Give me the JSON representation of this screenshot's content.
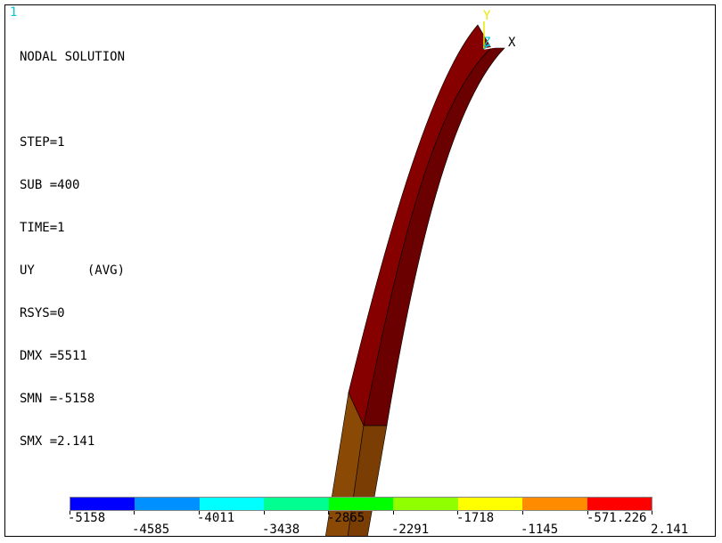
{
  "window_number": "1",
  "info_lines": [
    "NODAL SOLUTION",
    "",
    "STEP=1",
    "SUB =400",
    "TIME=1",
    "UY       (AVG)",
    "RSYS=0",
    "DMX =5511",
    "SMN =-5158",
    "SMX =2.141"
  ],
  "axes": {
    "y": "Y",
    "z": "Z",
    "x": "X"
  },
  "colors": {
    "beam_front": "#860000",
    "beam_side": "#6a0000",
    "beam_lower_front": "#8a4a06",
    "beam_lower_side": "#7a3e04",
    "axis_yellow": "#e8e800",
    "axis_cyan": "#00c8d8"
  },
  "legend": {
    "colors": [
      "#0000ff",
      "#0090ff",
      "#00ffff",
      "#00ff90",
      "#00ff00",
      "#90ff00",
      "#ffff00",
      "#ff8c00",
      "#ff0000"
    ],
    "top_labels": [
      "-5158",
      "-4011",
      "-2865",
      "-1718",
      "-571.226"
    ],
    "bottom_labels": [
      "-4585",
      "-3438",
      "-2291",
      "-1145",
      "2.141"
    ]
  }
}
